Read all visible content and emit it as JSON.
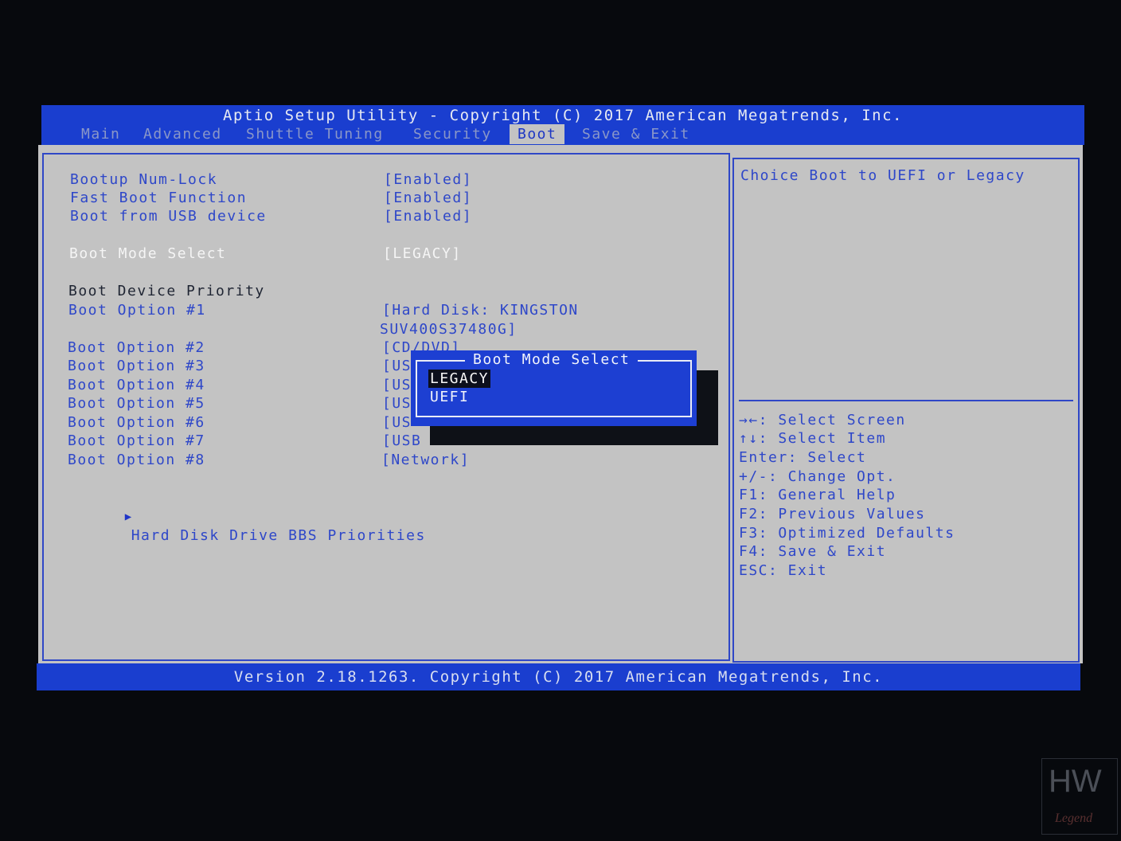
{
  "header": {
    "title": "Aptio Setup Utility - Copyright (C) 2017 American Megatrends, Inc.",
    "tabs": [
      "Main",
      "Advanced",
      "Shuttle Tuning",
      "Security",
      "Boot",
      "Save & Exit"
    ],
    "active_tab": "Boot"
  },
  "settings": [
    {
      "label": "Bootup Num-Lock",
      "value": "[Enabled]"
    },
    {
      "label": "Fast Boot Function",
      "value": "[Enabled]"
    },
    {
      "label": "Boot from USB device",
      "value": "[Enabled]"
    },
    {
      "label": "Boot Mode Select",
      "value": "[LEGACY]"
    },
    {
      "label": "Boot Device Priority",
      "value": ""
    },
    {
      "label": "Boot Option #1",
      "value": "[Hard Disk: KINGSTON",
      "value_line2": "SUV400S37480G]"
    },
    {
      "label": "Boot Option #2",
      "value": "[CD/DVD]"
    },
    {
      "label": "Boot Option #3",
      "value": "[US"
    },
    {
      "label": "Boot Option #4",
      "value": "[US"
    },
    {
      "label": "Boot Option #5",
      "value": "[US"
    },
    {
      "label": "Boot Option #6",
      "value": "[US"
    },
    {
      "label": "Boot Option #7",
      "value": "[USB"
    },
    {
      "label": "Boot Option #8",
      "value": "[Network]"
    }
  ],
  "submenu": {
    "arrow": "▶",
    "label": "Hard Disk Drive BBS Priorities"
  },
  "help": {
    "text": "Choice Boot to UEFI or Legacy",
    "keys": [
      "→←: Select Screen",
      "↑↓: Select Item",
      "Enter: Select",
      "+/-: Change Opt.",
      "F1: General Help",
      "F2: Previous Values",
      "F3: Optimized Defaults",
      "F4: Save & Exit",
      "ESC: Exit"
    ]
  },
  "popup": {
    "title": "Boot Mode Select",
    "options": [
      "LEGACY",
      "UEFI"
    ],
    "selected": "LEGACY"
  },
  "footer": {
    "text": "Version 2.18.1263. Copyright (C) 2017 American Megatrends, Inc."
  },
  "watermark": {
    "text": "HW",
    "sub": "Legend"
  },
  "colors": {
    "accent": "#1a3ecf",
    "panel_bg": "#c3c3c3",
    "text_blue": "#2e47c9"
  }
}
